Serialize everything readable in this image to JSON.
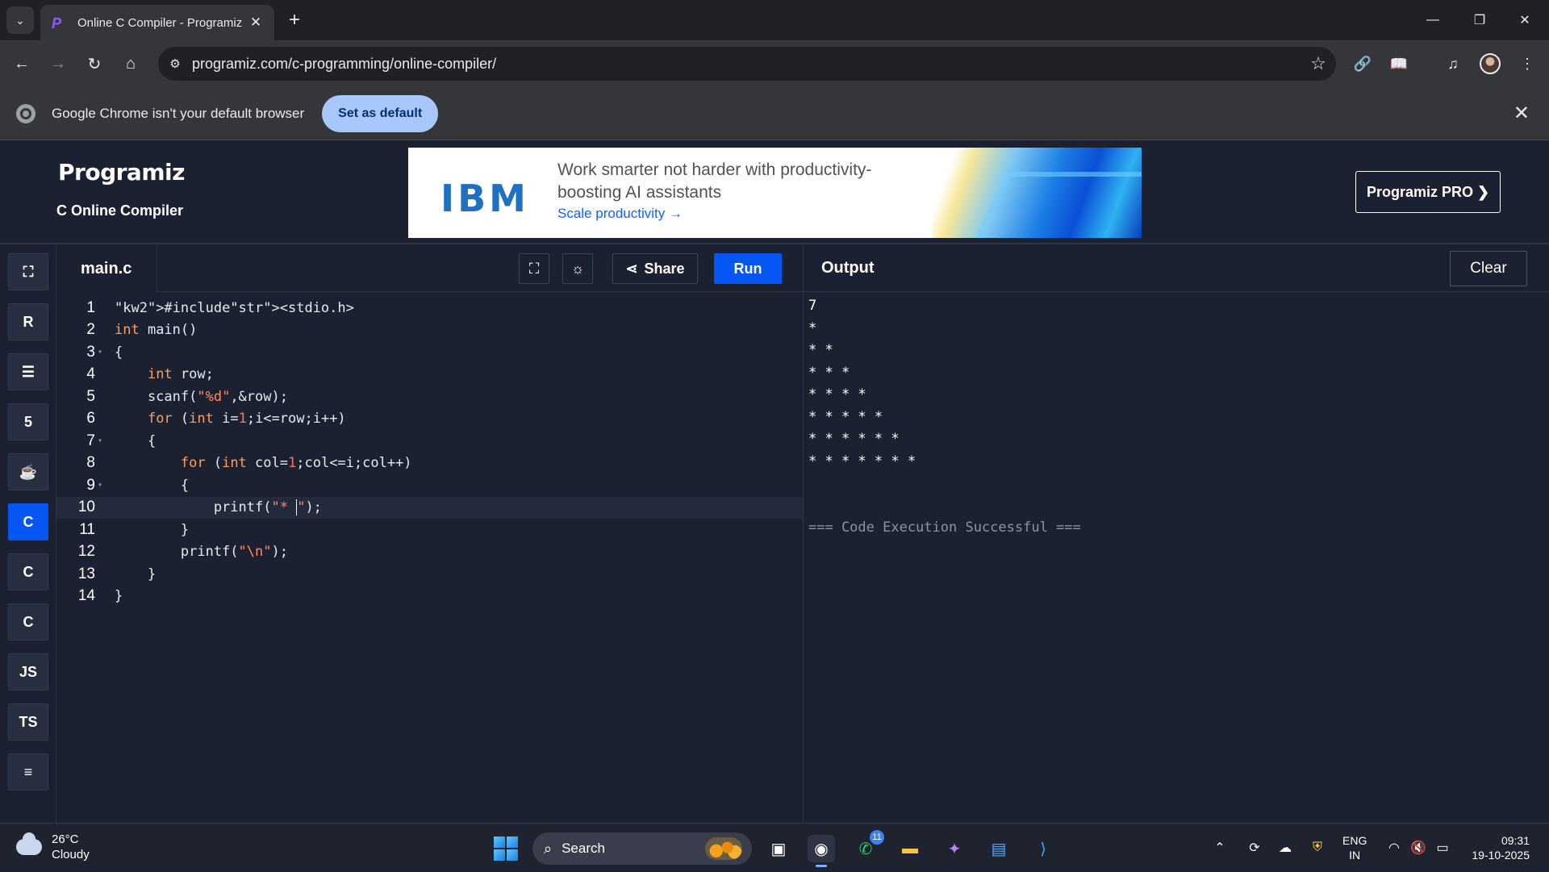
{
  "browser": {
    "tab_title": "Online C Compiler - Programiz",
    "url": "programiz.com/c-programming/online-compiler/",
    "window_controls": [
      "minimize",
      "restore",
      "close"
    ]
  },
  "infobar": {
    "message": "Google Chrome isn't your default browser",
    "button": "Set as default"
  },
  "site": {
    "logo": "Programiz",
    "subtitle": "C Online Compiler",
    "pro_button": "Programiz PRO ❯"
  },
  "ad": {
    "brand": "IBM",
    "headline": "Work smarter not harder with productivity-boosting AI assistants",
    "cta": "Scale productivity"
  },
  "sidebar": {
    "languages": [
      {
        "name": "python",
        "label": "",
        "active": false
      },
      {
        "name": "r",
        "label": "",
        "active": false
      },
      {
        "name": "sql",
        "label": "",
        "active": false
      },
      {
        "name": "html",
        "label": "",
        "active": false
      },
      {
        "name": "java",
        "label": "",
        "active": false
      },
      {
        "name": "c",
        "label": "",
        "active": true
      },
      {
        "name": "cpp",
        "label": "",
        "active": false
      },
      {
        "name": "csharp",
        "label": "",
        "active": false
      },
      {
        "name": "javascript",
        "label": "JS",
        "active": false
      },
      {
        "name": "typescript",
        "label": "TS",
        "active": false
      },
      {
        "name": "go",
        "label": "",
        "active": false
      }
    ]
  },
  "editor": {
    "file_name": "main.c",
    "share_label": "Share",
    "run_label": "Run",
    "lines": [
      "#include<stdio.h>",
      "int main()",
      "{",
      "    int row;",
      "    scanf(\"%d\",&row);",
      "    for (int i=1;i<=row;i++)",
      "    {",
      "        for (int col=1;col<=i;col++)",
      "        {",
      "            printf(\"* \");",
      "        }",
      "        printf(\"\\n\");",
      "    }",
      "}"
    ],
    "line_numbers": [
      "1",
      "2",
      "3",
      "4",
      "5",
      "6",
      "7",
      "8",
      "9",
      "10",
      "11",
      "12",
      "13",
      "14"
    ]
  },
  "output": {
    "title": "Output",
    "clear_label": "Clear",
    "text": "7\n*\n* *\n* * *\n* * * *\n* * * * *\n* * * * * *\n* * * * * * *\n\n\n=== Code Execution Successful ==="
  },
  "taskbar": {
    "temperature": "26°C",
    "condition": "Cloudy",
    "search_label": "Search",
    "whatsapp_badge": "11",
    "lang_line1": "ENG",
    "lang_line2": "IN",
    "time": "09:31",
    "date": "19-10-2025"
  }
}
